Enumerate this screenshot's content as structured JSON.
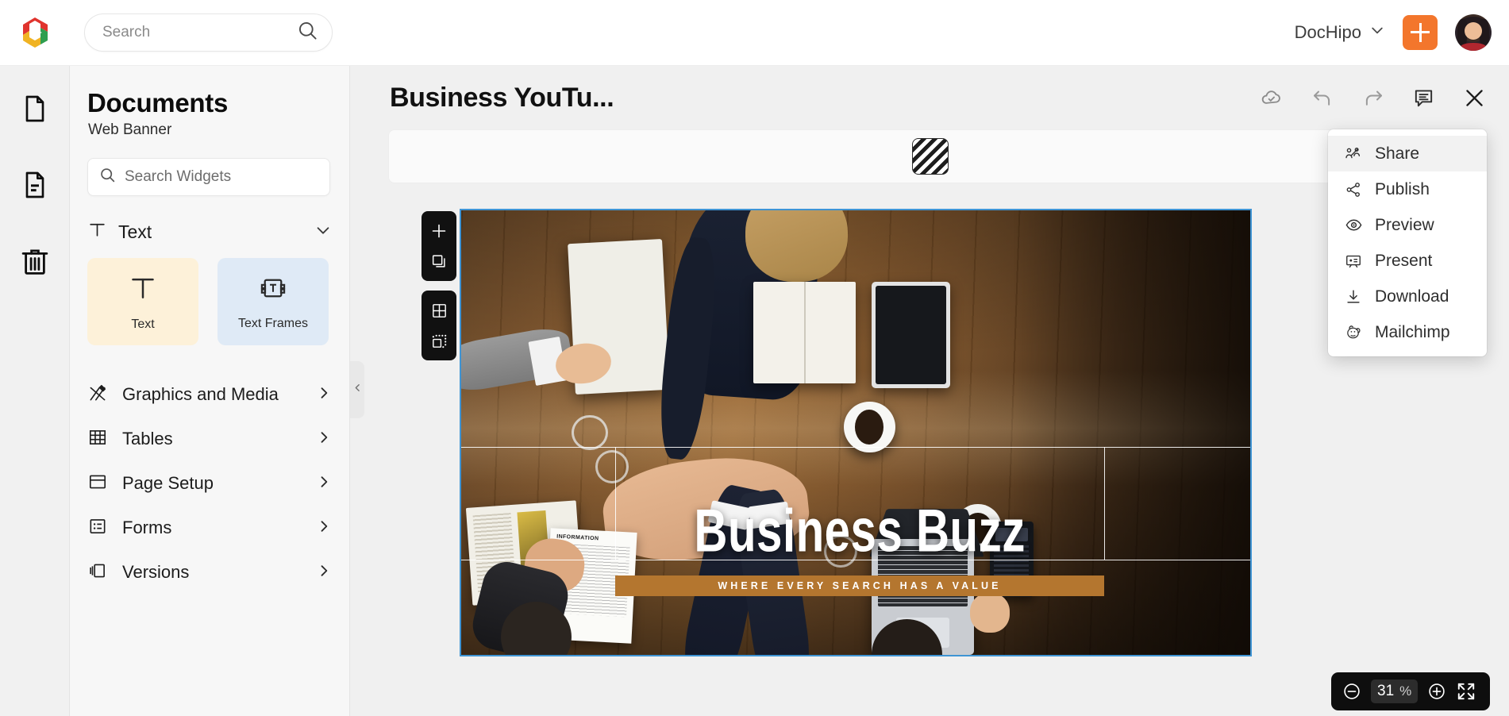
{
  "topbar": {
    "logo_icon": "dochipo-logo-icon",
    "search": {
      "placeholder": "Search",
      "value": "",
      "icon": "search-icon"
    },
    "workspace": {
      "label": "DocHipo",
      "chevron_icon": "chevron-down-icon"
    },
    "create_button": {
      "label": "+",
      "icon": "plus-icon"
    },
    "avatar_name": "user-avatar"
  },
  "rail": {
    "items": [
      {
        "name": "new-document",
        "icon": "document-blank-icon",
        "active": false
      },
      {
        "name": "my-documents",
        "icon": "document-lines-icon",
        "active": true
      },
      {
        "name": "trash",
        "icon": "trash-icon",
        "active": false
      }
    ]
  },
  "panel": {
    "title": "Documents",
    "subtitle": "Web Banner",
    "widget_search": {
      "placeholder": "Search Widgets",
      "value": "",
      "icon": "search-icon"
    },
    "text_section": {
      "label": "Text",
      "icon": "text-t-icon",
      "chevron_icon": "chevron-down-icon",
      "cards": [
        {
          "label": "Text",
          "icon": "text-t-icon",
          "color": "#fdf1d9"
        },
        {
          "label": "Text Frames",
          "icon": "text-frame-icon",
          "color": "#dfeaf6"
        }
      ]
    },
    "menu": [
      {
        "label": "Graphics and Media",
        "icon": "graphics-media-icon",
        "chevron_icon": "chevron-right-icon"
      },
      {
        "label": "Tables",
        "icon": "table-grid-icon",
        "chevron_icon": "chevron-right-icon"
      },
      {
        "label": "Page Setup",
        "icon": "page-setup-icon",
        "chevron_icon": "chevron-right-icon"
      },
      {
        "label": "Forms",
        "icon": "forms-icon",
        "chevron_icon": "chevron-right-icon"
      },
      {
        "label": "Versions",
        "icon": "versions-icon",
        "chevron_icon": "chevron-right-icon"
      }
    ],
    "collapse_handle_icon": "chevron-left-icon"
  },
  "editor": {
    "document_title": "Business YouTu...",
    "actions": [
      {
        "name": "cloud-saved",
        "icon": "cloud-check-icon"
      },
      {
        "name": "undo",
        "icon": "undo-arrow-icon"
      },
      {
        "name": "redo",
        "icon": "redo-arrow-icon"
      },
      {
        "name": "comments",
        "icon": "comment-icon"
      },
      {
        "name": "close",
        "icon": "close-x-icon"
      }
    ],
    "canvas_toolbar": {
      "fill_button_icon": "diagonal-stripe-fill-icon"
    },
    "float_tools": [
      {
        "name": "add-page",
        "icon": "plus-icon"
      },
      {
        "name": "duplicate-page",
        "icon": "duplicate-pages-icon"
      },
      {
        "name": "grid-view",
        "icon": "grid-icon"
      },
      {
        "name": "crop-select",
        "icon": "crop-select-icon"
      }
    ]
  },
  "banner": {
    "headline": "Business Buzz",
    "tagline": "WHERE EVERY SEARCH HAS A VALUE",
    "tagline_bar_color": "#b4762f",
    "document_label": "INFORMATION",
    "selection_color": "#3f94d4"
  },
  "dropdown": {
    "items": [
      {
        "label": "Share",
        "icon": "share-users-icon",
        "active": true
      },
      {
        "label": "Publish",
        "icon": "share-nodes-icon",
        "active": false
      },
      {
        "label": "Preview",
        "icon": "eye-icon",
        "active": false
      },
      {
        "label": "Present",
        "icon": "presentation-icon",
        "active": false
      },
      {
        "label": "Download",
        "icon": "download-arrow-icon",
        "active": false
      },
      {
        "label": "Mailchimp",
        "icon": "mailchimp-icon",
        "active": false
      }
    ]
  },
  "zoom": {
    "minus_icon": "zoom-out-icon",
    "value": "31",
    "unit": "%",
    "plus_icon": "zoom-in-icon",
    "fullscreen_icon": "fullscreen-icon"
  }
}
